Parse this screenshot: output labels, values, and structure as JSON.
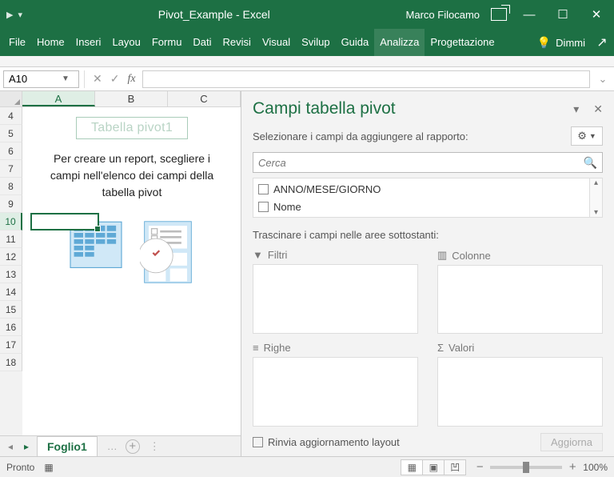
{
  "title": {
    "file": "Pivot_Example",
    "app": "Excel",
    "full": "Pivot_Example  -  Excel",
    "user": "Marco Filocamo"
  },
  "ribbon": {
    "tabs": [
      "File",
      "Home",
      "Inseri",
      "Layou",
      "Formu",
      "Dati",
      "Revisi",
      "Visual",
      "Svilup",
      "Guida",
      "Analizza",
      "Progettazione"
    ],
    "active": 10,
    "tell_me": "Dimmi"
  },
  "namebox": {
    "value": "A10"
  },
  "columns": [
    "A",
    "B",
    "C"
  ],
  "active_col_idx": 0,
  "rows": [
    4,
    5,
    6,
    7,
    8,
    9,
    10,
    11,
    12,
    13,
    14,
    15,
    16,
    17,
    18
  ],
  "active_row": 10,
  "pivot_placeholder": {
    "title": "Tabella pivot1",
    "msg": "Per creare un report, scegliere i campi nell'elenco dei campi della tabella pivot"
  },
  "sheet_tabs": {
    "active": "Foglio1"
  },
  "pane": {
    "title": "Campi tabella pivot",
    "subtitle": "Selezionare i campi da aggiungere al rapporto:",
    "search_placeholder": "Cerca",
    "fields": [
      "ANNO/MESE/GIORNO",
      "Nome"
    ],
    "drag_label": "Trascinare i campi nelle aree sottostanti:",
    "areas": {
      "filters": "Filtri",
      "columns": "Colonne",
      "rows": "Righe",
      "values": "Valori"
    },
    "defer_label": "Rinvia aggiornamento layout",
    "update_btn": "Aggiorna"
  },
  "status": {
    "ready": "Pronto",
    "zoom": "100%"
  }
}
